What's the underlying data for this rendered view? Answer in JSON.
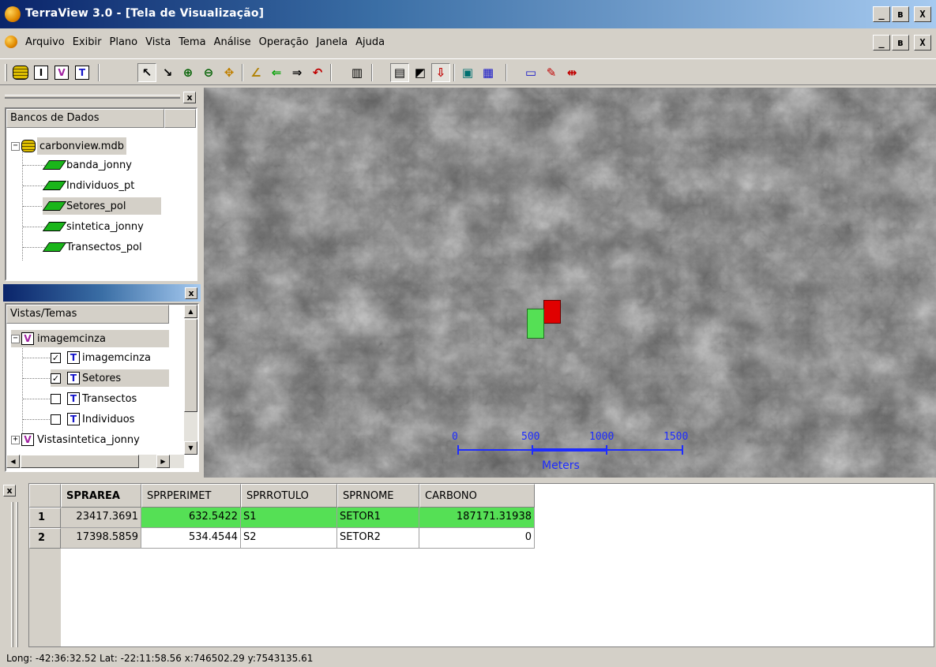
{
  "window": {
    "title": "TerraView 3.0 - [Tela de Visualização]",
    "min_label": "_",
    "max_label": "ʙ",
    "close_label": "X"
  },
  "menu": {
    "items": [
      "Arquivo",
      "Exibir",
      "Plano",
      "Vista",
      "Tema",
      "Análise",
      "Operação",
      "Janela",
      "Ajuda"
    ]
  },
  "toolbar": {
    "buttons": [
      {
        "name": "database-icon"
      },
      {
        "name": "infolayer-icon",
        "glyph": "I"
      },
      {
        "name": "view-icon",
        "glyph": "V"
      },
      {
        "name": "theme-icon",
        "glyph": "T"
      },
      {
        "name": "pointer-icon",
        "glyph": "↖"
      },
      {
        "name": "info-tool-icon",
        "glyph": "↘"
      },
      {
        "name": "zoom-in-icon",
        "glyph": "⊕"
      },
      {
        "name": "zoom-out-icon",
        "glyph": "⊖"
      },
      {
        "name": "pan-icon",
        "glyph": "✥"
      },
      {
        "name": "draw-icon",
        "glyph": "∠"
      },
      {
        "name": "back-icon",
        "glyph": "⇐"
      },
      {
        "name": "forward-icon",
        "glyph": "⇒"
      },
      {
        "name": "undo-icon",
        "glyph": "↶"
      },
      {
        "name": "grid-icon",
        "glyph": "▥"
      },
      {
        "name": "print-icon",
        "glyph": "▤"
      },
      {
        "name": "graphic-icon",
        "glyph": "◩"
      },
      {
        "name": "import-icon",
        "glyph": "⇩"
      },
      {
        "name": "display-icon",
        "glyph": "▣"
      },
      {
        "name": "histogram-icon",
        "glyph": "▦"
      },
      {
        "name": "legend-icon",
        "glyph": "▭"
      },
      {
        "name": "edit-icon",
        "glyph": "✎"
      },
      {
        "name": "measure-icon",
        "glyph": "⇹"
      }
    ],
    "accent": "#1414c8"
  },
  "db_panel": {
    "close_label": "x",
    "header": "Bancos de Dados",
    "database": "carbonview.mdb",
    "layers": [
      "banda_jonny",
      "Individuos_pt",
      "Setores_pol",
      "sintetica_jonny",
      "Transectos_pol"
    ],
    "selected_layer": "Setores_pol"
  },
  "views_panel": {
    "close_label": "x",
    "header": "Vistas/Temas",
    "view1": "imagemcinza",
    "themes": [
      {
        "label": "imagemcinza",
        "checked": true
      },
      {
        "label": "Setores",
        "checked": true
      },
      {
        "label": "Transectos",
        "checked": false
      },
      {
        "label": "Individuos",
        "checked": false
      }
    ],
    "view2": "Vistasintetica_jonny",
    "check_mark": "✓",
    "expander": "−"
  },
  "map": {
    "scale_labels": [
      "0",
      "500",
      "1000",
      "1500"
    ],
    "scale_unit": "Meters",
    "red_color": "#e00000",
    "green_color": "#55e055",
    "scale_color": "#1e2cff"
  },
  "table": {
    "close_label": "x",
    "columns": [
      "SPRAREA",
      "SPRPERIMET",
      "SPRROTULO",
      "SPRNOME",
      "CARBONO"
    ],
    "rows": [
      {
        "index": "1",
        "cells": [
          "23417.3691",
          "632.5422",
          "S1",
          "SETOR1",
          "187171.31938"
        ]
      },
      {
        "index": "2",
        "cells": [
          "17398.5859",
          "534.4544",
          "S2",
          "SETOR2",
          "0"
        ]
      }
    ]
  },
  "status": {
    "text": "Long: -42:36:32.52 Lat: -22:11:58.56  x:746502.29  y:7543135.61"
  }
}
